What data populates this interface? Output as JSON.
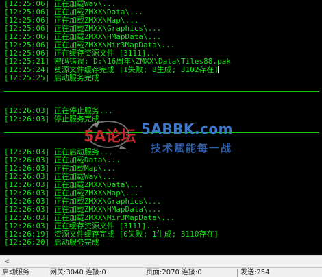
{
  "console": {
    "lines": [
      "[12:25:06] 正在加载Wav\\...",
      "[12:25:06] 正在加载ZMXX\\Data\\...",
      "[12:25:06] 正在加载ZMXX\\Map\\...",
      "[12:25:06] 正在加载ZMXX\\Graphics\\...",
      "[12:25:06] 正在加载ZMXX\\HMapData\\...",
      "[12:25:06] 正在加载ZMXX\\Mir3MapData\\...",
      "[12:25:06] 正在缓存资源文件 [3111]...",
      "[12:25:21] 密码错误: D:\\16周年\\ZMXX\\Data\\Tiles88.pak",
      "[12:25:24] 资源文件缓存完成 [1失败; 8生成; 3102存在]",
      "[12:25:25] 启动服务完成",
      "[12:26:03] 正在停止服务...",
      "[12:26:03] 停止服务完成",
      "[12:26:03] 正在启动服务...",
      "[12:26:03] 正在加载Data\\...",
      "[12:26:03] 正在加载Map\\...",
      "[12:26:03] 正在加载Wav\\...",
      "[12:26:03] 正在加载ZMXX\\Data\\...",
      "[12:26:03] 正在加载ZMXX\\Map\\...",
      "[12:26:03] 正在加载ZMXX\\Graphics\\...",
      "[12:26:03] 正在加载ZMXX\\HMapData\\...",
      "[12:26:03] 正在加载ZMXX\\Mir3MapData\\...",
      "[12:26:03] 正在缓存资源文件 [3111]...",
      "[12:26:19] 资源文件缓存完成 [0失败; 1生成; 3110存在]",
      "[12:26:20] 启动服务完成"
    ]
  },
  "watermark": {
    "site": "5ABBK.com",
    "slogan": "技术赋能每一战",
    "logo_text": "5A论坛"
  },
  "scrollbar": {
    "left_arrow": "<"
  },
  "statusbar": {
    "cells": [
      "启动服务",
      "网关:3040 连接:0",
      "页面:2070 连接:0",
      "发送:254"
    ]
  },
  "colors": {
    "console_bg": "#000000",
    "console_text": "#17e217",
    "divider": "#17c617",
    "watermark_blue": "#3e78c9",
    "watermark_red": "#c0282d"
  }
}
